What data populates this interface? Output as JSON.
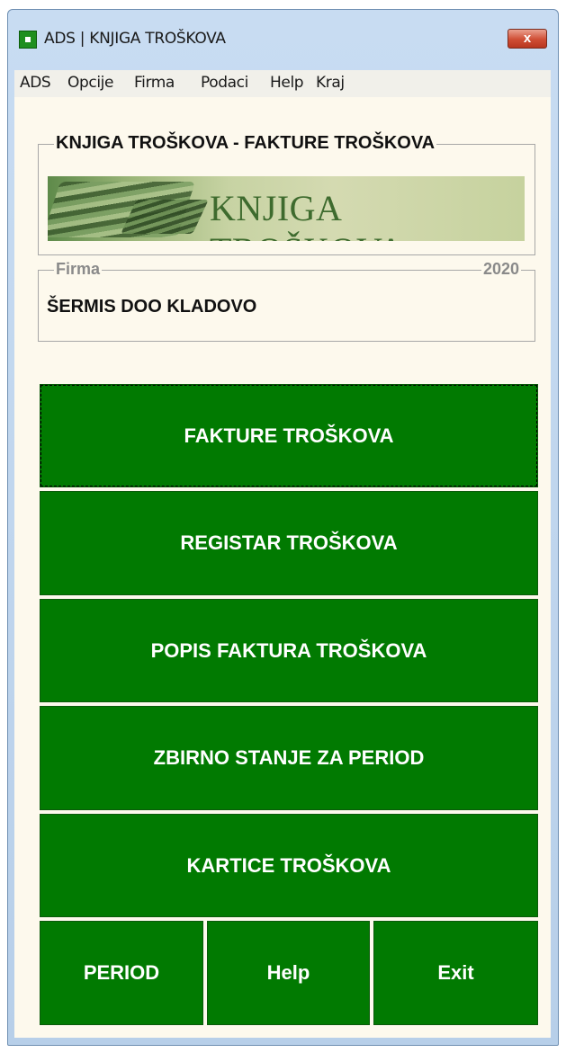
{
  "window": {
    "title": "ADS | KNJIGA TROŠKOVA",
    "close_label": "x"
  },
  "menu": [
    {
      "label": "ADS"
    },
    {
      "label": "Opcije"
    },
    {
      "label": "Firma"
    },
    {
      "label": "Podaci"
    },
    {
      "label": "Help"
    },
    {
      "label": "Kraj"
    }
  ],
  "header_group": {
    "legend": "KNJIGA TROŠKOVA - FAKTURE TROŠKOVA"
  },
  "banner": {
    "text": "KNJIGA TROŠKOVA"
  },
  "firma_group": {
    "legend": "Firma",
    "year": "2020",
    "company": "ŠERMIS DOO KLADOVO"
  },
  "buttons": [
    {
      "label": "FAKTURE TROŠKOVA"
    },
    {
      "label": "REGISTAR TROŠKOVA"
    },
    {
      "label": "POPIS FAKTURA TROŠKOVA"
    },
    {
      "label": "ZBIRNO STANJE ZA PERIOD"
    },
    {
      "label": "KARTICE TROŠKOVA"
    }
  ],
  "bottom_buttons": [
    {
      "label": "PERIOD"
    },
    {
      "label": "Help"
    },
    {
      "label": "Exit"
    }
  ],
  "colors": {
    "button_green": "#017a01",
    "client_bg": "#fdf9ed"
  }
}
